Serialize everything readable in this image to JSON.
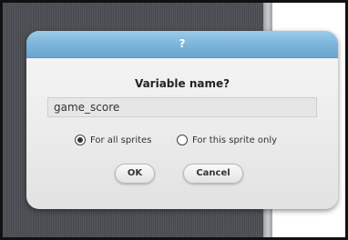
{
  "dialog": {
    "title": "?",
    "prompt": "Variable name?",
    "input_value": "game_score",
    "options": [
      {
        "label": "For all sprites",
        "selected": true
      },
      {
        "label": "For this sprite only",
        "selected": false
      }
    ],
    "ok_label": "OK",
    "cancel_label": "Cancel"
  },
  "colors": {
    "titlebar": "#7ab3da",
    "dialog_body": "#ececec",
    "backdrop": "#4f5257",
    "stage": "#ffffff"
  }
}
